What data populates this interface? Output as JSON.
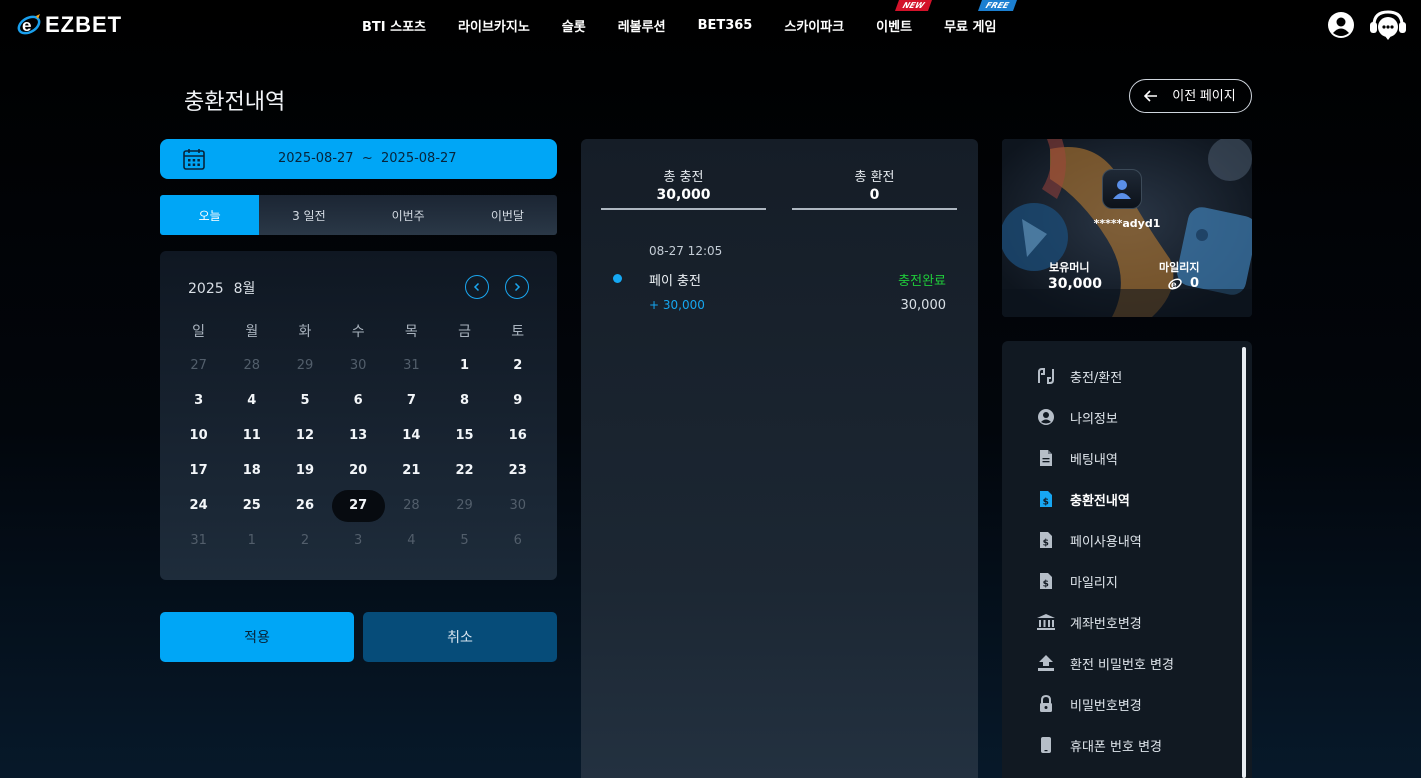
{
  "brand": {
    "name": "EZBET"
  },
  "nav": [
    {
      "label": "BTI 스포츠"
    },
    {
      "label": "라이브카지노"
    },
    {
      "label": "슬롯"
    },
    {
      "label": "레볼루션"
    },
    {
      "label": "BET365"
    },
    {
      "label": "스카이파크"
    },
    {
      "label": "이벤트",
      "badge": "NEW"
    },
    {
      "label": "무료 게임",
      "badge": "FREE"
    }
  ],
  "page": {
    "title": "충환전내역",
    "back_label": "이전 페이지"
  },
  "filter": {
    "date_from": "2025-08-27",
    "date_sep": "~",
    "date_to": "2025-08-27",
    "tabs": [
      "오늘",
      "3 일전",
      "이번주",
      "이번달"
    ],
    "active_tab": 0
  },
  "calendar": {
    "year": "2025",
    "month": "8월",
    "weekdays": [
      "일",
      "월",
      "화",
      "수",
      "목",
      "금",
      "토"
    ],
    "days": [
      [
        "27",
        "m"
      ],
      [
        "28",
        "m"
      ],
      [
        "29",
        "m"
      ],
      [
        "30",
        "m"
      ],
      [
        "31",
        "m"
      ],
      [
        "1",
        ""
      ],
      [
        "2",
        ""
      ],
      [
        "3",
        ""
      ],
      [
        "4",
        ""
      ],
      [
        "5",
        ""
      ],
      [
        "6",
        ""
      ],
      [
        "7",
        ""
      ],
      [
        "8",
        ""
      ],
      [
        "9",
        ""
      ],
      [
        "10",
        ""
      ],
      [
        "11",
        ""
      ],
      [
        "12",
        ""
      ],
      [
        "13",
        ""
      ],
      [
        "14",
        ""
      ],
      [
        "15",
        ""
      ],
      [
        "16",
        ""
      ],
      [
        "17",
        ""
      ],
      [
        "18",
        ""
      ],
      [
        "19",
        ""
      ],
      [
        "20",
        ""
      ],
      [
        "21",
        ""
      ],
      [
        "22",
        ""
      ],
      [
        "23",
        ""
      ],
      [
        "24",
        ""
      ],
      [
        "25",
        ""
      ],
      [
        "26",
        ""
      ],
      [
        "27",
        "s"
      ],
      [
        "28",
        "m"
      ],
      [
        "29",
        "m"
      ],
      [
        "30",
        "m"
      ],
      [
        "31",
        "m"
      ],
      [
        "1",
        "m"
      ],
      [
        "2",
        "m"
      ],
      [
        "3",
        "m"
      ],
      [
        "4",
        "m"
      ],
      [
        "5",
        "m"
      ],
      [
        "6",
        "m"
      ]
    ],
    "apply_label": "적용",
    "cancel_label": "취소"
  },
  "summary": {
    "charge_label": "총 충전",
    "charge_value": "30,000",
    "withdraw_label": "총 환전",
    "withdraw_value": "0"
  },
  "transactions": [
    {
      "time": "08-27 12:05",
      "type": "페이 충전",
      "status": "충전완료",
      "amount": "+ 30,000",
      "balance": "30,000"
    }
  ],
  "profile": {
    "username": "*****adyd1",
    "money_label": "보유머니",
    "money_value": "30,000",
    "mileage_label": "마일리지",
    "mileage_value": "0"
  },
  "menu": [
    {
      "label": "충전/환전",
      "icon": "exchange-icon"
    },
    {
      "label": "나의정보",
      "icon": "user-circle-icon"
    },
    {
      "label": "베팅내역",
      "icon": "document-icon"
    },
    {
      "label": "충환전내역",
      "icon": "document-dollar-icon",
      "active": true
    },
    {
      "label": "페이사용내역",
      "icon": "document-dollar-icon"
    },
    {
      "label": "마일리지",
      "icon": "document-dollar-icon"
    },
    {
      "label": "계좌번호변경",
      "icon": "bank-icon"
    },
    {
      "label": "환전 비밀번호 변경",
      "icon": "upload-tray-icon"
    },
    {
      "label": "비밀번호변경",
      "icon": "lock-icon"
    },
    {
      "label": "휴대폰 번호 변경",
      "icon": "phone-icon"
    }
  ],
  "colors": {
    "accent": "#00a6f6",
    "success": "#1fcc3a",
    "badge_new": "#d3122a",
    "badge_free": "#1b7fd1"
  }
}
